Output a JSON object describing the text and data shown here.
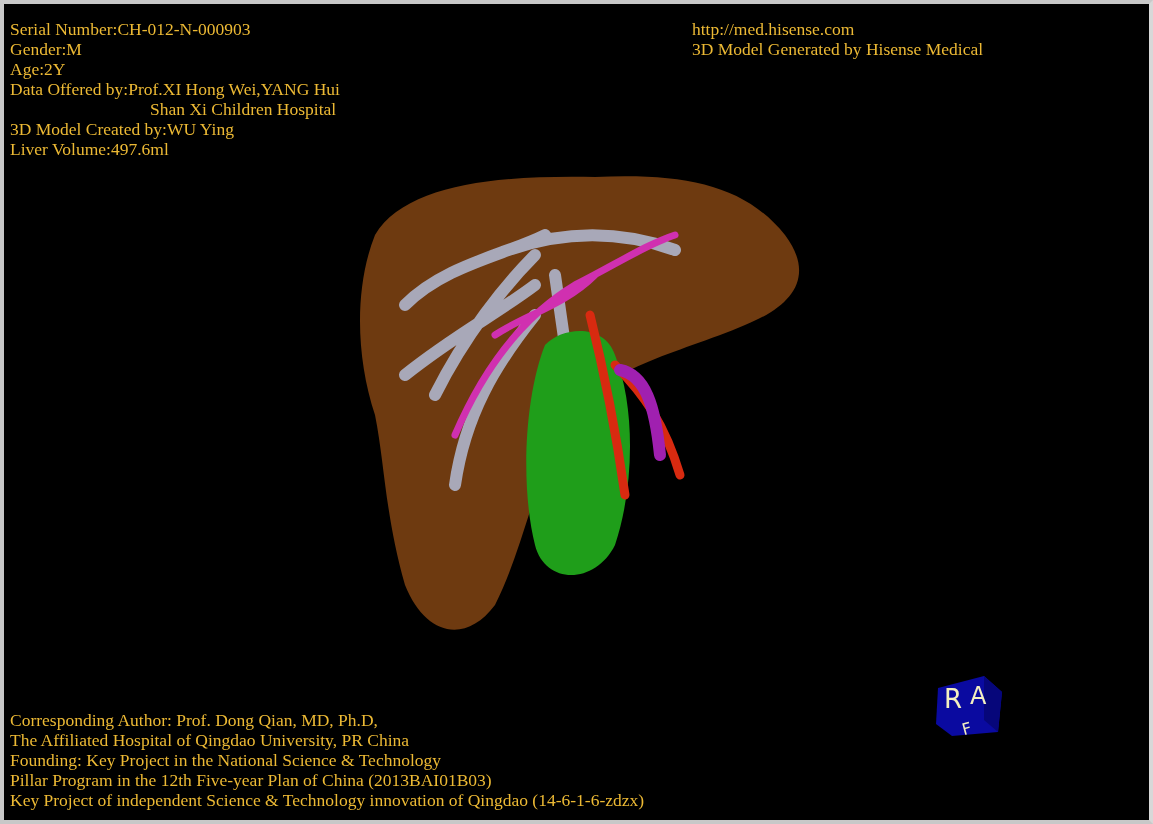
{
  "patient_info": [
    {
      "text": "Serial Number:CH-012-N-000903",
      "kind": "line"
    },
    {
      "text": "Gender:M",
      "kind": "line"
    },
    {
      "text": "Age:2Y",
      "kind": "line"
    },
    {
      "text": "Data Offered by:Prof.XI Hong Wei,YANG Hui",
      "kind": "line"
    },
    {
      "text": "Shan Xi Children Hospital",
      "kind": "continuation"
    },
    {
      "text": "3D Model Created by:WU Ying",
      "kind": "line"
    },
    {
      "text": "Liver Volume:497.6ml",
      "kind": "line"
    }
  ],
  "generator_info": [
    {
      "text": "http://med.hisense.com",
      "kind": "line"
    },
    {
      "text": "3D Model Generated by Hisense Medical",
      "kind": "line"
    }
  ],
  "credits": [
    "Corresponding Author: Prof. Dong Qian, MD, Ph.D,",
    "The Affiliated Hospital of Qingdao University, PR China",
    "Founding: Key Project in the National Science & Technology",
    "Pillar Program in the 12th Five-year Plan of China (2013BAI01B03)",
    "Key Project of independent Science & Technology innovation of Qingdao (14-6-1-6-zdzx)"
  ],
  "orientation_cube": {
    "front": "R",
    "right": "A",
    "bottom": "F"
  }
}
